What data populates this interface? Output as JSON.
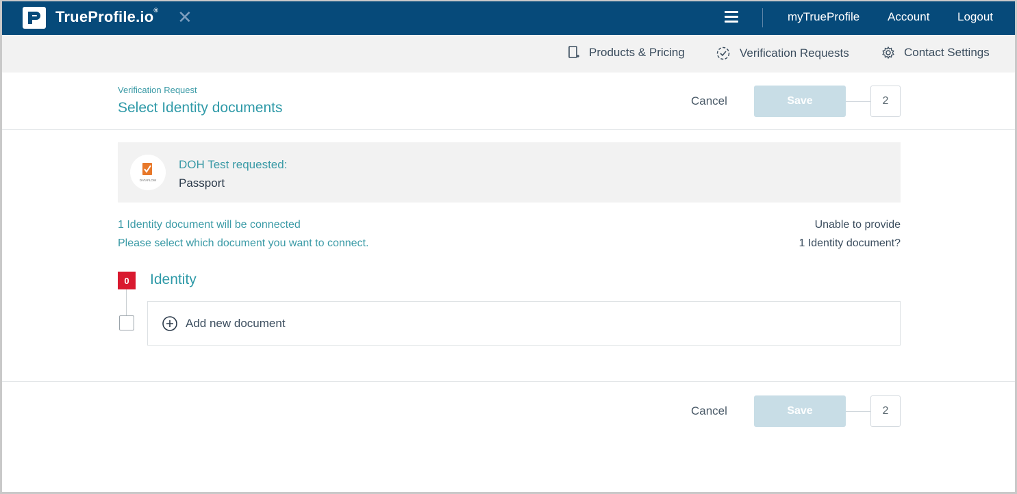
{
  "topbar": {
    "brand": "TrueProfile.io",
    "brand_mark": "®",
    "close_glyph": "✕",
    "links": [
      "myTrueProfile",
      "Account",
      "Logout"
    ]
  },
  "subnav": {
    "items": [
      {
        "label": "Products & Pricing",
        "icon": "tablet-icon"
      },
      {
        "label": "Verification Requests",
        "icon": "check-circle-icon"
      },
      {
        "label": "Contact Settings",
        "icon": "gear-icon"
      }
    ]
  },
  "header": {
    "eyebrow": "Verification Request",
    "title": "Select Identity documents",
    "cancel_label": "Cancel",
    "save_label": "Save",
    "step": "2"
  },
  "request": {
    "title": "DOH Test requested:",
    "item": "Passport",
    "logo_text": "DATAFLOW"
  },
  "info": {
    "line1": "1 Identity document will be connected",
    "line2": "Please select which document you want to connect.",
    "unable_line1": "Unable to provide",
    "unable_line2": "1 Identity document?"
  },
  "identity": {
    "count": "0",
    "label": "Identity",
    "add_label": "Add new document"
  },
  "footer": {
    "cancel_label": "Cancel",
    "save_label": "Save",
    "step": "2"
  },
  "colors": {
    "topbar": "#064a7a",
    "accent_teal": "#2f9aa8",
    "save_disabled": "#c8dde6",
    "badge_red": "#d9192f"
  }
}
